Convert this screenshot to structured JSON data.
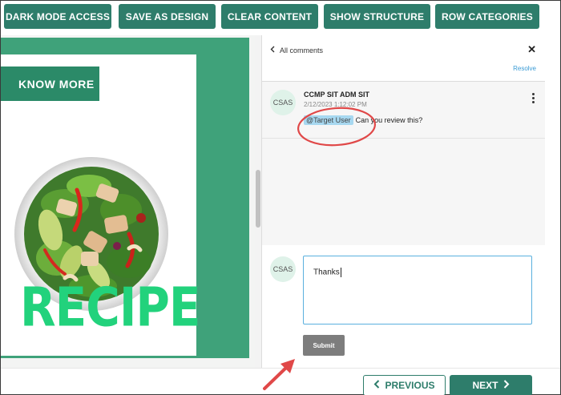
{
  "toolbar": {
    "buttons": [
      {
        "label": "DARK MODE ACCESS"
      },
      {
        "label": "SAVE AS DESIGN"
      },
      {
        "label": "CLEAR CONTENT"
      },
      {
        "label": "SHOW STRUCTURE"
      },
      {
        "label": "ROW CATEGORIES"
      }
    ]
  },
  "canvas": {
    "know_more_label": "KNOW MORE",
    "recipe_word": "RECIPE"
  },
  "comments": {
    "back_label": "All comments",
    "close_icon": "close-icon",
    "resolve_label": "Resolve",
    "thread": [
      {
        "avatar": "CSAS",
        "author": "CCMP SIT ADM SIT",
        "timestamp": "2/12/2023 1:12:02 PM",
        "mention": "@Target User",
        "text": "Can you review this?"
      }
    ],
    "reply": {
      "avatar": "CSAS",
      "value": "Thanks",
      "submit_label": "Submit"
    }
  },
  "navigation": {
    "previous_label": "PREVIOUS",
    "next_label": "NEXT"
  },
  "colors": {
    "primary": "#2e7d6b",
    "canvas_green": "#3fa27a",
    "recipe_green": "#22d27c",
    "annotation_red": "#e04848",
    "focus_blue": "#5ab0de"
  }
}
